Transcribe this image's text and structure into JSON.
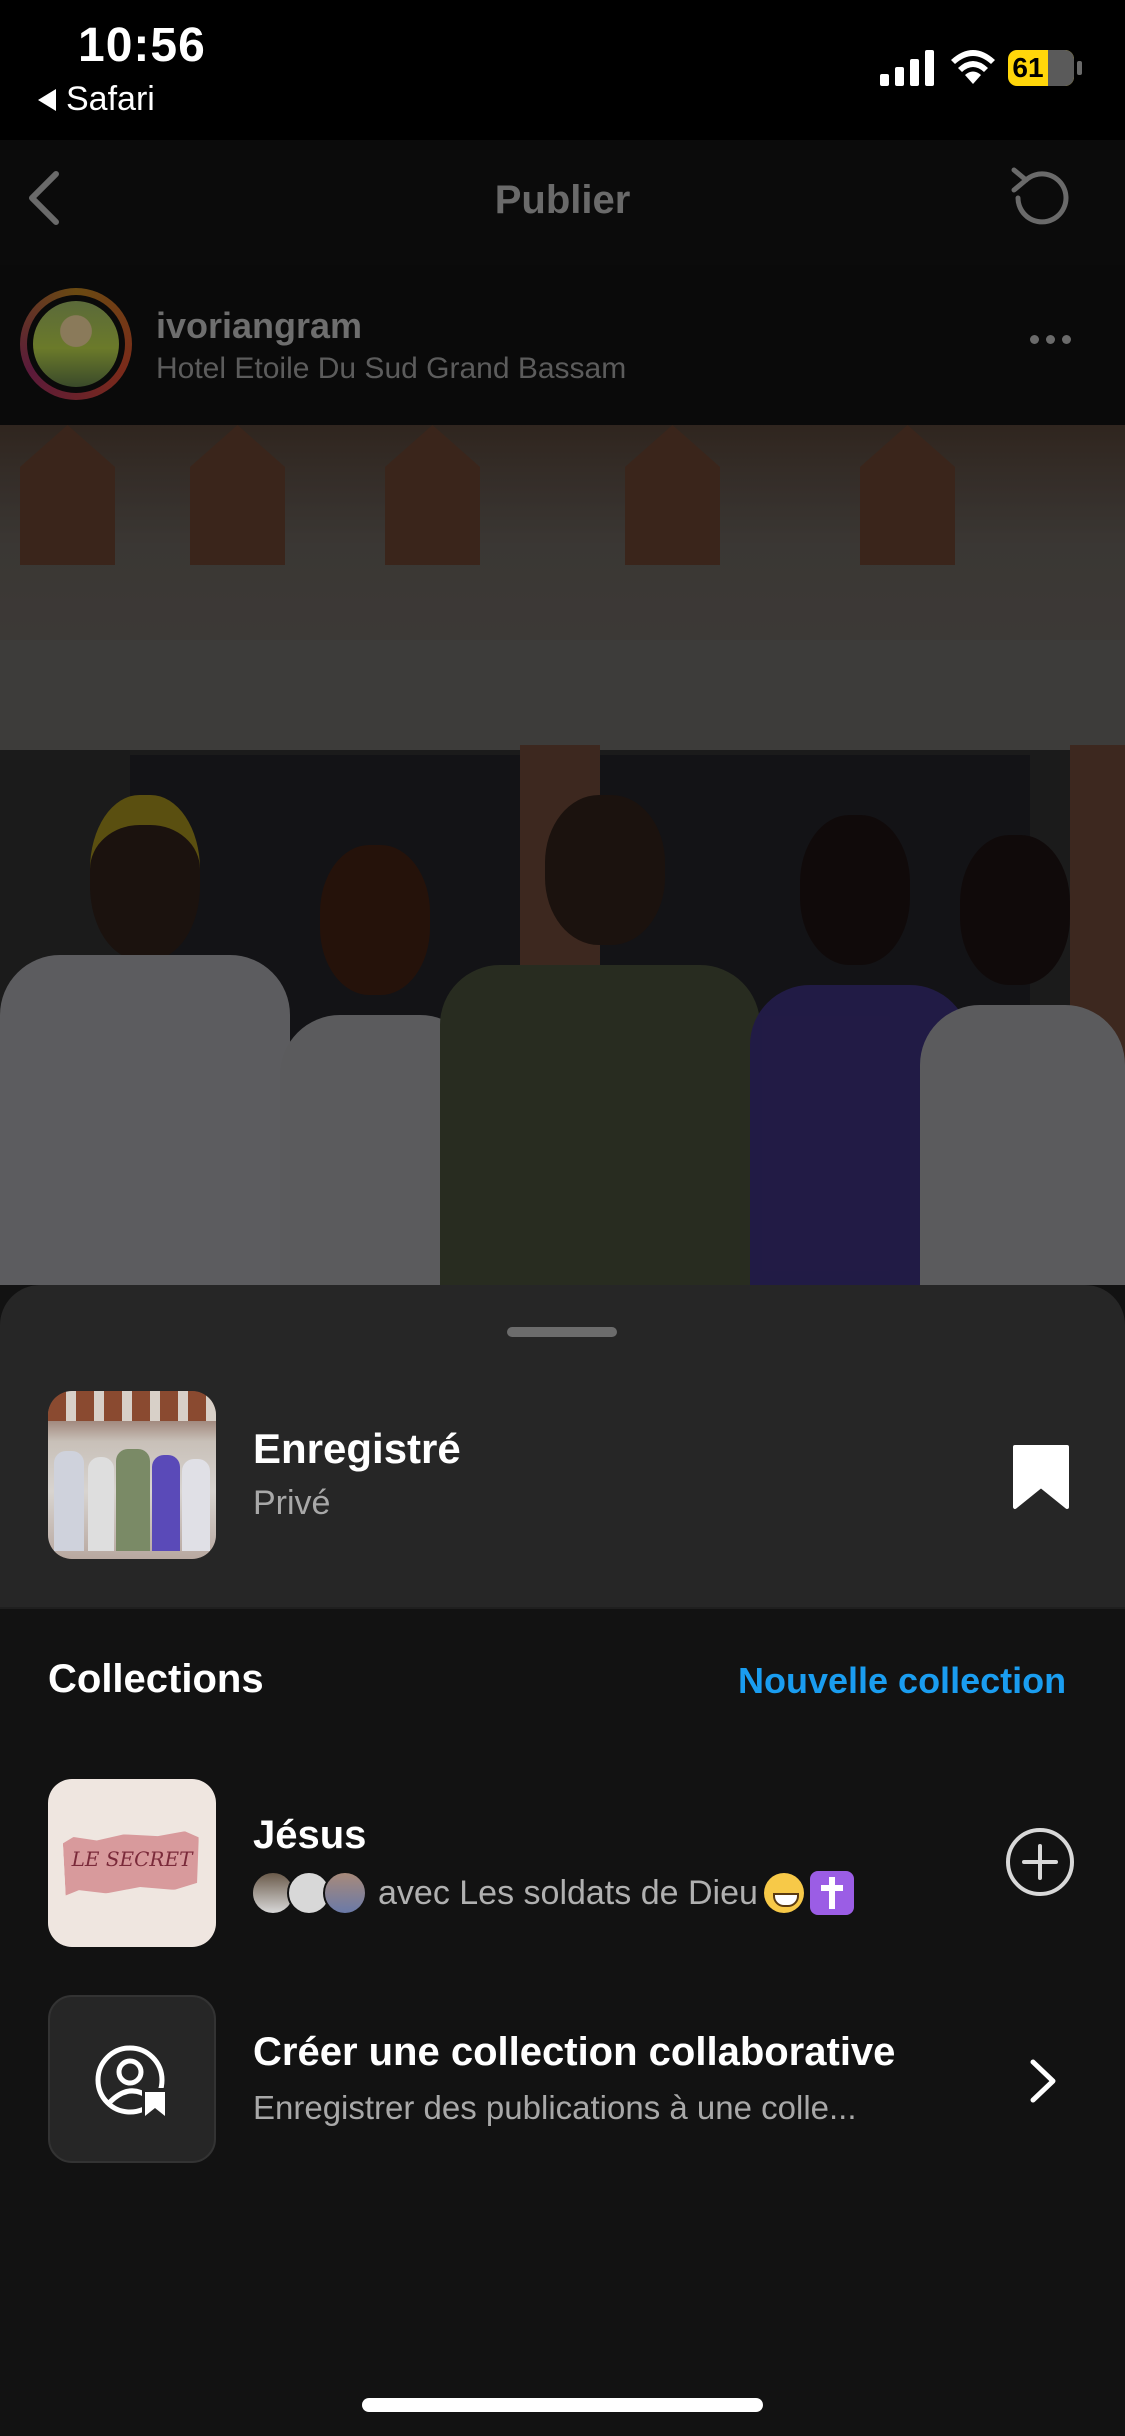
{
  "status_bar": {
    "time": "10:56",
    "back_app": "Safari",
    "battery": "61"
  },
  "header": {
    "title": "Publier"
  },
  "post": {
    "username": "ivoriangram",
    "location": "Hotel Etoile Du Sud Grand Bassam"
  },
  "saved": {
    "title": "Enregistré",
    "subtitle": "Privé"
  },
  "collections": {
    "title": "Collections",
    "new_label": "Nouvelle collection",
    "items": [
      {
        "title": "Jésus",
        "thumb_text": "LE SECRET",
        "subtitle": "avec Les soldats de Dieu"
      }
    ],
    "create": {
      "title": "Créer une collection collaborative",
      "subtitle": "Enregistrer des publications à une colle..."
    }
  },
  "colors": {
    "accent": "#1a9df0",
    "sheet_top": "#262626",
    "background": "#121212"
  }
}
